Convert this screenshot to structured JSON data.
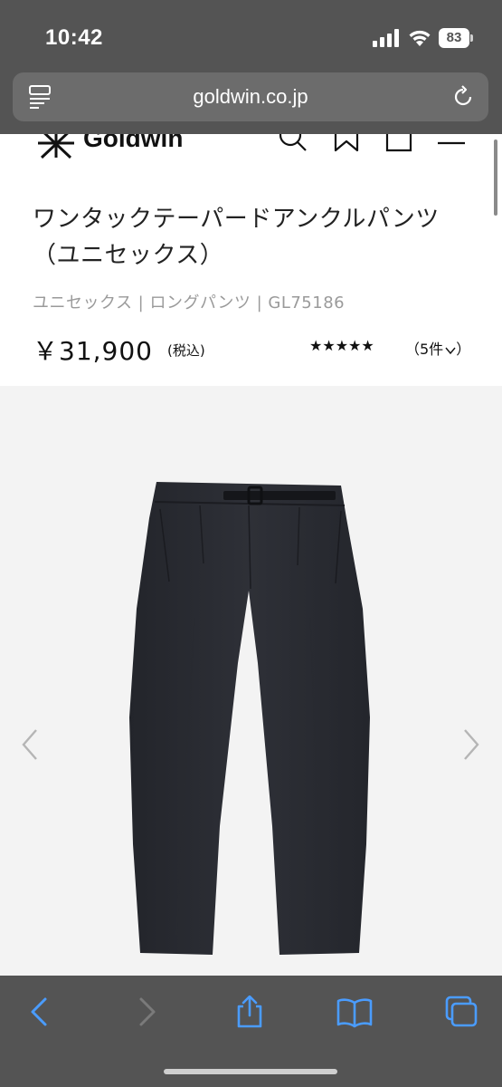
{
  "status": {
    "time": "10:42",
    "battery": "83"
  },
  "browser": {
    "url": "goldwin.co.jp"
  },
  "header": {
    "logo_text": "Goldwin"
  },
  "product": {
    "title": "ワンタックテーパードアンクルパンツ（ユニセックス）",
    "breadcrumb": "ユニセックス | ロングパンツ | GL75186",
    "price": "￥31,900",
    "tax_note": "(税込)",
    "rating_stars": "★★★★★",
    "rating_count": "（5件",
    "rating_stars_value": 5
  },
  "colors": {
    "browser_chrome": "#545454",
    "url_field": "#6c6c6c",
    "toolbar_icon_active": "#4a9cff",
    "toolbar_icon_inactive": "#7a7a7a",
    "gallery_bg": "#f3f3f3",
    "pants": "#2a2c33"
  },
  "icons": {
    "reader": "reader-mode-icon",
    "reload": "reload-icon",
    "search": "search-icon",
    "favorite": "bookmark-ribbon-icon",
    "cart": "cart-icon",
    "menu": "hamburger-menu-icon",
    "prev": "chevron-left-icon",
    "next": "chevron-right-icon",
    "back": "back-arrow-icon",
    "forward": "forward-arrow-icon",
    "share": "share-icon",
    "bookmarks": "book-icon",
    "tabs": "tabs-icon"
  }
}
